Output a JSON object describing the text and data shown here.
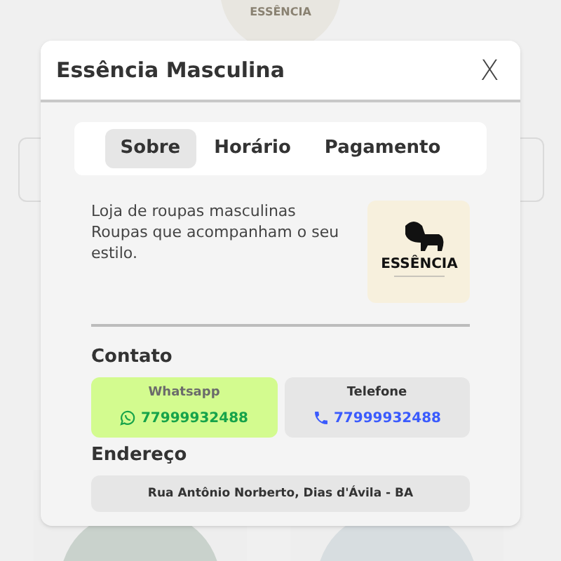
{
  "background": {
    "logo_text": "ESSÊNCIA"
  },
  "modal": {
    "title": "Essência Masculina",
    "close": "X",
    "tabs": [
      {
        "label": "Sobre",
        "selected": true
      },
      {
        "label": "Horário",
        "selected": false
      },
      {
        "label": "Pagamento",
        "selected": false
      }
    ],
    "description": [
      "Loja de roupas masculinas",
      "Roupas que acompanham o seu estilo."
    ],
    "logo_text": "ESSÊNCIA",
    "contact_heading": "Contato",
    "contacts": [
      {
        "kind": "whatsapp",
        "label": "Whatsapp",
        "number": "77999932488"
      },
      {
        "kind": "phone",
        "label": "Telefone",
        "number": "77999932488"
      }
    ],
    "address_heading": "Endereço",
    "address": "Rua Antônio Norberto, Dias d'Ávila - BA"
  }
}
